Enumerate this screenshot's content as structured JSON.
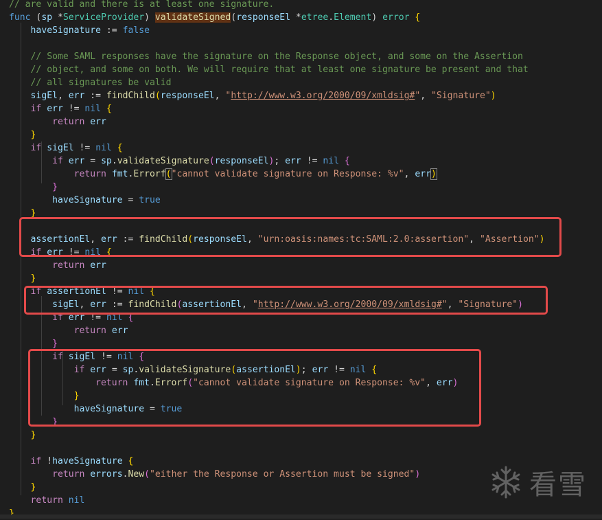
{
  "lines": [
    [
      [
        "cm",
        "// are valid and there is at least one signature."
      ]
    ],
    [
      [
        "kw",
        "func"
      ],
      [
        "pn",
        " ("
      ],
      [
        "var",
        "sp"
      ],
      [
        "pn",
        " *"
      ],
      [
        "ty",
        "ServiceProvider"
      ],
      [
        "pn",
        ") "
      ],
      [
        "fn hl",
        "validateSigned"
      ],
      [
        "pn",
        "("
      ],
      [
        "var",
        "responseEl"
      ],
      [
        "pn",
        " *"
      ],
      [
        "ty",
        "etree"
      ],
      [
        "pn",
        "."
      ],
      [
        "ty",
        "Element"
      ],
      [
        "pn",
        ") "
      ],
      [
        "ty",
        "error"
      ],
      [
        "br1",
        " {"
      ]
    ],
    [
      [
        "pn",
        "    "
      ],
      [
        "var",
        "haveSignature"
      ],
      [
        "pn",
        " := "
      ],
      [
        "kw",
        "false"
      ]
    ],
    [],
    [
      [
        "pn",
        "    "
      ],
      [
        "cm",
        "// Some SAML responses have the signature on the Response object, and some on the Assertion"
      ]
    ],
    [
      [
        "pn",
        "    "
      ],
      [
        "cm",
        "// object, and some on both. We will require that at least one signature be present and that"
      ]
    ],
    [
      [
        "pn",
        "    "
      ],
      [
        "cm",
        "// all signatures be valid"
      ]
    ],
    [
      [
        "pn",
        "    "
      ],
      [
        "var",
        "sigEl"
      ],
      [
        "pn",
        ", "
      ],
      [
        "var",
        "err"
      ],
      [
        "pn",
        " := "
      ],
      [
        "fn",
        "findChild"
      ],
      [
        "br1",
        "("
      ],
      [
        "var",
        "responseEl"
      ],
      [
        "pn",
        ", "
      ],
      [
        "str",
        "\""
      ],
      [
        "url",
        "http://www.w3.org/2000/09/xmldsig#"
      ],
      [
        "str",
        "\""
      ],
      [
        "pn",
        ", "
      ],
      [
        "str",
        "\"Signature\""
      ],
      [
        "br1",
        ")"
      ]
    ],
    [
      [
        "pn",
        "    "
      ],
      [
        "ctl",
        "if"
      ],
      [
        "pn",
        " "
      ],
      [
        "var",
        "err"
      ],
      [
        "pn",
        " != "
      ],
      [
        "kw",
        "nil"
      ],
      [
        "br1",
        " {"
      ]
    ],
    [
      [
        "pn",
        "        "
      ],
      [
        "ctl",
        "return"
      ],
      [
        "pn",
        " "
      ],
      [
        "var",
        "err"
      ]
    ],
    [
      [
        "pn",
        "    "
      ],
      [
        "br1",
        "}"
      ]
    ],
    [
      [
        "pn",
        "    "
      ],
      [
        "ctl",
        "if"
      ],
      [
        "pn",
        " "
      ],
      [
        "var",
        "sigEl"
      ],
      [
        "pn",
        " != "
      ],
      [
        "kw",
        "nil"
      ],
      [
        "br1",
        " {"
      ]
    ],
    [
      [
        "pn",
        "        "
      ],
      [
        "ctl",
        "if"
      ],
      [
        "pn",
        " "
      ],
      [
        "var",
        "err"
      ],
      [
        "pn",
        " = "
      ],
      [
        "var",
        "sp"
      ],
      [
        "pn",
        "."
      ],
      [
        "fn",
        "validateSignature"
      ],
      [
        "br2",
        "("
      ],
      [
        "var",
        "responseEl"
      ],
      [
        "br2",
        ")"
      ],
      [
        "pn",
        "; "
      ],
      [
        "var",
        "err"
      ],
      [
        "pn",
        " != "
      ],
      [
        "kw",
        "nil"
      ],
      [
        "br2",
        " {"
      ]
    ],
    [
      [
        "pn",
        "            "
      ],
      [
        "ctl",
        "return"
      ],
      [
        "pn",
        " "
      ],
      [
        "var",
        "fmt"
      ],
      [
        "pn",
        "."
      ],
      [
        "fn",
        "Errorf"
      ],
      [
        "br1 bm",
        "("
      ],
      [
        "str",
        "\"cannot validate signature on Response: %v\""
      ],
      [
        "pn",
        ", "
      ],
      [
        "var",
        "err"
      ],
      [
        "br1 bm",
        ")"
      ]
    ],
    [
      [
        "pn",
        "        "
      ],
      [
        "br2",
        "}"
      ]
    ],
    [
      [
        "pn",
        "        "
      ],
      [
        "var",
        "haveSignature"
      ],
      [
        "pn",
        " = "
      ],
      [
        "kw",
        "true"
      ]
    ],
    [
      [
        "pn",
        "    "
      ],
      [
        "br1",
        "}"
      ]
    ],
    [],
    [
      [
        "pn",
        "    "
      ],
      [
        "var",
        "assertionEl"
      ],
      [
        "pn",
        ", "
      ],
      [
        "var",
        "err"
      ],
      [
        "pn",
        " := "
      ],
      [
        "fn",
        "findChild"
      ],
      [
        "br1",
        "("
      ],
      [
        "var",
        "responseEl"
      ],
      [
        "pn",
        ", "
      ],
      [
        "str",
        "\"urn:oasis:names:tc:SAML:2.0:assertion\""
      ],
      [
        "pn",
        ", "
      ],
      [
        "str",
        "\"Assertion\""
      ],
      [
        "br1",
        ")"
      ]
    ],
    [
      [
        "pn",
        "    "
      ],
      [
        "ctl",
        "if"
      ],
      [
        "pn",
        " "
      ],
      [
        "var",
        "err"
      ],
      [
        "pn",
        " != "
      ],
      [
        "kw",
        "nil"
      ],
      [
        "br1",
        " {"
      ]
    ],
    [
      [
        "pn",
        "        "
      ],
      [
        "ctl",
        "return"
      ],
      [
        "pn",
        " "
      ],
      [
        "var",
        "err"
      ]
    ],
    [
      [
        "pn",
        "    "
      ],
      [
        "br1",
        "}"
      ]
    ],
    [
      [
        "pn",
        "    "
      ],
      [
        "ctl",
        "if"
      ],
      [
        "pn",
        " "
      ],
      [
        "var",
        "assertionEl"
      ],
      [
        "pn",
        " != "
      ],
      [
        "kw",
        "nil"
      ],
      [
        "br1",
        " {"
      ]
    ],
    [
      [
        "pn",
        "        "
      ],
      [
        "var",
        "sigEl"
      ],
      [
        "pn",
        ", "
      ],
      [
        "var",
        "err"
      ],
      [
        "pn",
        " := "
      ],
      [
        "fn",
        "findChild"
      ],
      [
        "br2",
        "("
      ],
      [
        "var",
        "assertionEl"
      ],
      [
        "pn",
        ", "
      ],
      [
        "str",
        "\""
      ],
      [
        "url",
        "http://www.w3.org/2000/09/xmldsig#"
      ],
      [
        "str",
        "\""
      ],
      [
        "pn",
        ", "
      ],
      [
        "str",
        "\"Signature\""
      ],
      [
        "br2",
        ")"
      ]
    ],
    [
      [
        "pn",
        "        "
      ],
      [
        "ctl",
        "if"
      ],
      [
        "pn",
        " "
      ],
      [
        "var",
        "err"
      ],
      [
        "pn",
        " != "
      ],
      [
        "kw",
        "nil"
      ],
      [
        "br2",
        " {"
      ]
    ],
    [
      [
        "pn",
        "            "
      ],
      [
        "ctl",
        "return"
      ],
      [
        "pn",
        " "
      ],
      [
        "var",
        "err"
      ]
    ],
    [
      [
        "pn",
        "        "
      ],
      [
        "br2",
        "}"
      ]
    ],
    [
      [
        "pn",
        "        "
      ],
      [
        "ctl",
        "if"
      ],
      [
        "pn",
        " "
      ],
      [
        "var",
        "sigEl"
      ],
      [
        "pn",
        " != "
      ],
      [
        "kw",
        "nil"
      ],
      [
        "br2",
        " {"
      ]
    ],
    [
      [
        "pn",
        "            "
      ],
      [
        "ctl",
        "if"
      ],
      [
        "pn",
        " "
      ],
      [
        "var",
        "err"
      ],
      [
        "pn",
        " = "
      ],
      [
        "var",
        "sp"
      ],
      [
        "pn",
        "."
      ],
      [
        "fn",
        "validateSignature"
      ],
      [
        "br1",
        "("
      ],
      [
        "var",
        "assertionEl"
      ],
      [
        "br1",
        ")"
      ],
      [
        "pn",
        "; "
      ],
      [
        "var",
        "err"
      ],
      [
        "pn",
        " != "
      ],
      [
        "kw",
        "nil"
      ],
      [
        "br1",
        " {"
      ]
    ],
    [
      [
        "pn",
        "                "
      ],
      [
        "ctl",
        "return"
      ],
      [
        "pn",
        " "
      ],
      [
        "var",
        "fmt"
      ],
      [
        "pn",
        "."
      ],
      [
        "fn",
        "Errorf"
      ],
      [
        "br2",
        "("
      ],
      [
        "str",
        "\"cannot validate signature on Response: %v\""
      ],
      [
        "pn",
        ", "
      ],
      [
        "var",
        "err"
      ],
      [
        "br2",
        ")"
      ]
    ],
    [
      [
        "pn",
        "            "
      ],
      [
        "br1",
        "}"
      ]
    ],
    [
      [
        "pn",
        "            "
      ],
      [
        "var",
        "haveSignature"
      ],
      [
        "pn",
        " = "
      ],
      [
        "kw",
        "true"
      ]
    ],
    [
      [
        "pn",
        "        "
      ],
      [
        "br2",
        "}"
      ]
    ],
    [
      [
        "pn",
        "    "
      ],
      [
        "br1",
        "}"
      ]
    ],
    [],
    [
      [
        "pn",
        "    "
      ],
      [
        "ctl",
        "if"
      ],
      [
        "pn",
        " !"
      ],
      [
        "var",
        "haveSignature"
      ],
      [
        "br1",
        " {"
      ]
    ],
    [
      [
        "pn",
        "        "
      ],
      [
        "ctl",
        "return"
      ],
      [
        "pn",
        " "
      ],
      [
        "var",
        "errors"
      ],
      [
        "pn",
        "."
      ],
      [
        "fn",
        "New"
      ],
      [
        "br2",
        "("
      ],
      [
        "str",
        "\"either the Response or Assertion must be signed\""
      ],
      [
        "br2",
        ")"
      ]
    ],
    [
      [
        "pn",
        "    "
      ],
      [
        "br1",
        "}"
      ]
    ],
    [
      [
        "pn",
        "    "
      ],
      [
        "ctl",
        "return"
      ],
      [
        "pn",
        " "
      ],
      [
        "kw",
        "nil"
      ]
    ],
    [
      [
        "br1",
        "}"
      ]
    ]
  ],
  "watermark": {
    "text": "看雪",
    "icon": "snowflake-icon"
  },
  "colors": {
    "background": "#1e1e1e",
    "highlight_box": "#e34a4a"
  }
}
